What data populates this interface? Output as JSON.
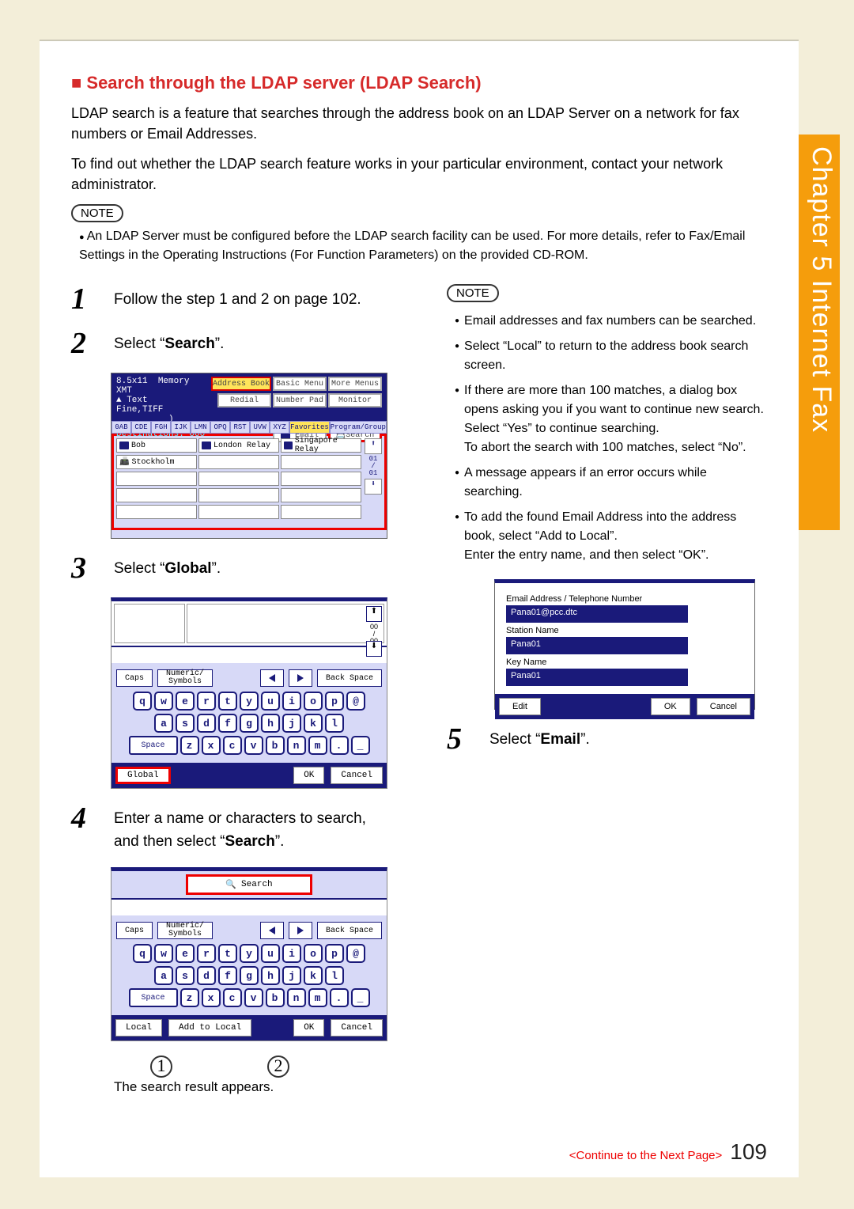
{
  "chapter_tab": "Chapter 5    Internet Fax",
  "heading": "■ Search through the LDAP server (LDAP Search)",
  "intro1": "LDAP search is a feature that searches through the address book on an LDAP Server on a network for fax numbers or Email Addresses.",
  "intro2": "To find out whether the LDAP search feature works in your particular environment, contact your network administrator.",
  "note_label": "NOTE",
  "note1": "An LDAP Server must be configured before the LDAP search facility can be used. For more details, refer to Fax/Email Settings in the Operating Instructions (For Function Parameters) on the provided CD-ROM.",
  "steps": {
    "s1": "Follow the step 1 and 2 on page 102.",
    "s2_pre": "Select “",
    "s2_bold": "Search",
    "s2_post": "”.",
    "s3_pre": "Select “",
    "s3_bold": "Global",
    "s3_post": "”.",
    "s4_pre": "Enter a name or characters to search, and then select “",
    "s4_bold": "Search",
    "s4_post": "”.",
    "s4_after": "The search result appears.",
    "s5_pre": "Select “",
    "s5_bold": "Email",
    "s5_post": "”."
  },
  "right_notes": [
    "Email addresses and fax numbers can be searched.",
    "Select “Local” to return to the address book search screen.",
    "If there are more than 100 matches, a dialog box opens asking you if you want to continue new search. Select “Yes” to continue searching.\nTo abort the search with 100 matches, select “No”.",
    "A message appears if an error occurs while searching.",
    "To add the found Email Address into the address book, select “Add to Local”.\nEnter the entry name, and then select “OK”."
  ],
  "fig1": {
    "title1": "8.5x11",
    "title2": "Memory XMT",
    "title3": "Text",
    "title4": "Fine,TIFF",
    "dest": "Destinations: 000",
    "addrbook": "Address Book",
    "basic": "Basic Menu",
    "more": "More Menus",
    "redial": "Redial",
    "numpad": "Number Pad",
    "monitor": "Monitor",
    "email": "Email",
    "search": "Search",
    "tabs": [
      "0AB",
      "CDE",
      "FGH",
      "IJK",
      "LMN",
      "OPQ",
      "RST",
      "UVW",
      "XYZ",
      "Favorites",
      "Program/Group"
    ],
    "rows": [
      [
        "Bob",
        "London Relay",
        "Singapore Relay"
      ],
      [
        "Stockholm",
        "",
        ""
      ],
      [
        "",
        "",
        ""
      ],
      [
        "",
        "",
        ""
      ],
      [
        "",
        "",
        ""
      ]
    ],
    "scroll": "01\n/\n01"
  },
  "kb_common": {
    "caps": "Caps",
    "numsym": "Numeric/\nSymbols",
    "back": "Back Space",
    "space": "Space",
    "ok": "OK",
    "cancel": "Cancel",
    "row1": [
      "q",
      "w",
      "e",
      "r",
      "t",
      "y",
      "u",
      "i",
      "o",
      "p",
      "@"
    ],
    "row2": [
      "a",
      "s",
      "d",
      "f",
      "g",
      "h",
      "j",
      "k",
      "l"
    ],
    "row3": [
      "z",
      "x",
      "c",
      "v",
      "b",
      "n",
      "m",
      "."
    ]
  },
  "fig2": {
    "global": "Global",
    "scroll": "00\n/\n00"
  },
  "fig3": {
    "search": "Search",
    "local": "Local",
    "add": "Add to Local"
  },
  "fig4": {
    "h": "Email Address / Telephone Number",
    "email": "Pana01@pcc.dtc",
    "l2": "Station Name",
    "v2": "Pana01",
    "l3": "Key Name",
    "v3": "Pana01",
    "edit": "Edit",
    "ok": "OK",
    "cancel": "Cancel"
  },
  "footer": {
    "continue": "<Continue to the Next Page>",
    "page": "109"
  }
}
